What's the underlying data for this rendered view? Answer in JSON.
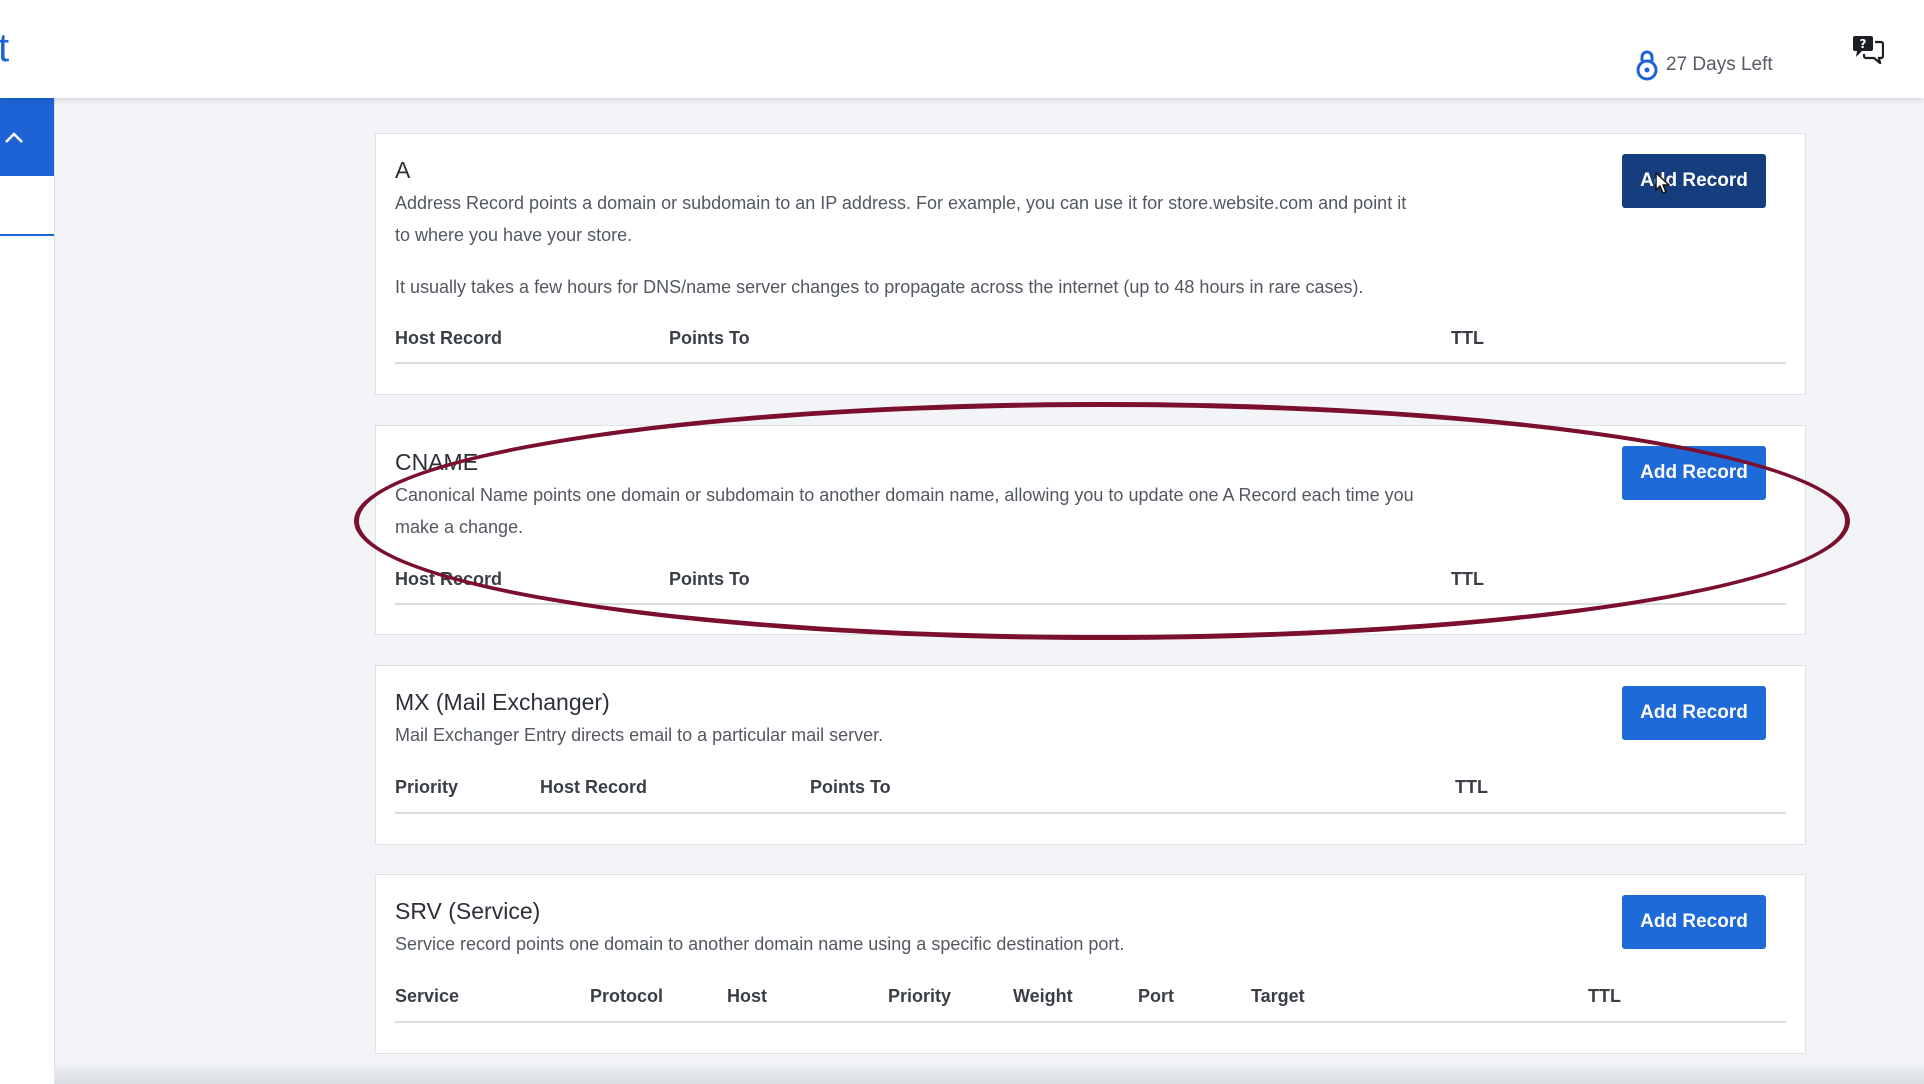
{
  "header": {
    "logo_fragment": "t",
    "trial_text": "27 Days Left",
    "icons": {
      "trial": "lock-icon",
      "help": "chat-help-icon",
      "collapse": "chevron-up-icon"
    }
  },
  "colors": {
    "primary": "#1f6ad9",
    "button_hover": "#163d7d",
    "highlight_ring": "#7a0f2e",
    "background": "#f2f4f7"
  },
  "records": {
    "a": {
      "title": "A",
      "description": "Address Record points a domain or subdomain to an IP address. For example, you can use it for store.website.com and point it to where you have your store.",
      "note": "It usually takes a few hours for DNS/name server changes to propagate across the internet (up to 48 hours in rare cases).",
      "button": "Add Record",
      "columns": [
        "Host Record",
        "Points To",
        "TTL"
      ]
    },
    "cname": {
      "title": "CNAME",
      "description": "Canonical Name points one domain or subdomain to another domain name, allowing you to update one A Record each time you make a change.",
      "button": "Add Record",
      "columns": [
        "Host Record",
        "Points To",
        "TTL"
      ]
    },
    "mx": {
      "title": "MX (Mail Exchanger)",
      "description": "Mail Exchanger Entry directs email to a particular mail server.",
      "button": "Add Record",
      "columns": [
        "Priority",
        "Host Record",
        "Points To",
        "TTL"
      ]
    },
    "srv": {
      "title": "SRV (Service)",
      "description": "Service record points one domain to another domain name using a specific destination port.",
      "button": "Add Record",
      "columns": [
        "Service",
        "Protocol",
        "Host",
        "Priority",
        "Weight",
        "Port",
        "Target",
        "TTL"
      ]
    }
  }
}
